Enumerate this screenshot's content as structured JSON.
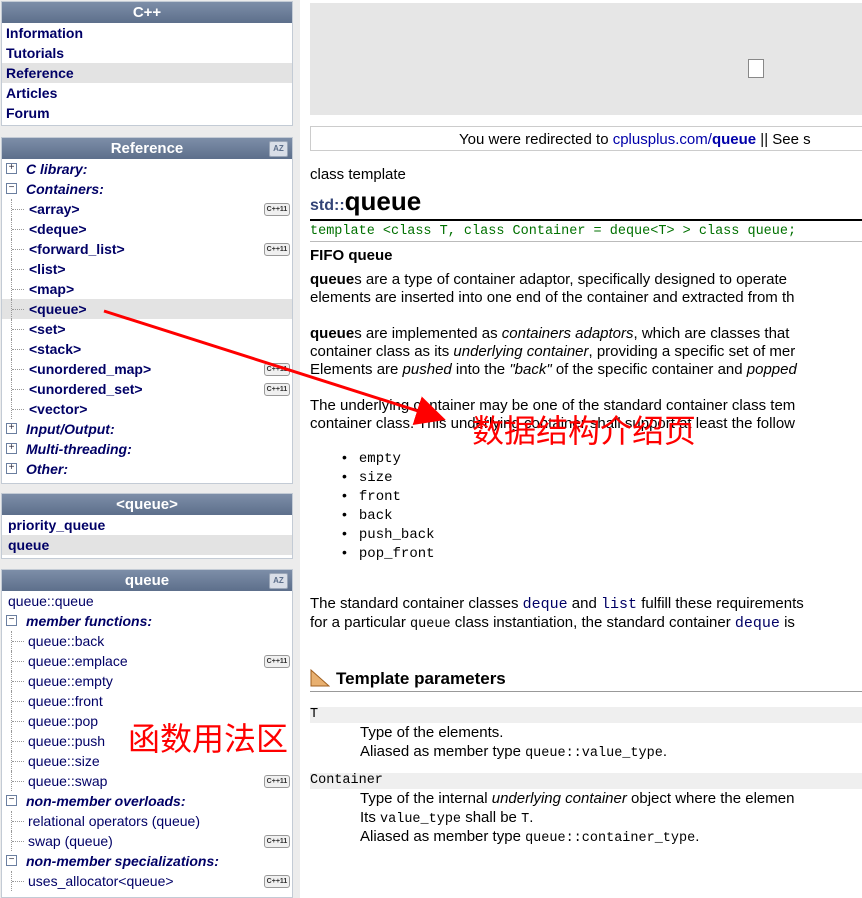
{
  "cpp_box": {
    "title": "C++",
    "items": [
      "Information",
      "Tutorials",
      "Reference",
      "Articles",
      "Forum"
    ],
    "selected": "Reference"
  },
  "reference_box": {
    "title": "Reference",
    "book_icon": "book-icon",
    "rows": [
      {
        "type": "cat",
        "label": "C library:",
        "pm": "+"
      },
      {
        "type": "cat",
        "label": "Containers:",
        "pm": "-"
      },
      {
        "type": "ent",
        "label": "<array>",
        "badge": "C++11"
      },
      {
        "type": "ent",
        "label": "<deque>"
      },
      {
        "type": "ent",
        "label": "<forward_list>",
        "badge": "C++11"
      },
      {
        "type": "ent",
        "label": "<list>"
      },
      {
        "type": "ent",
        "label": "<map>"
      },
      {
        "type": "ent",
        "label": "<queue>",
        "selected": true
      },
      {
        "type": "ent",
        "label": "<set>"
      },
      {
        "type": "ent",
        "label": "<stack>"
      },
      {
        "type": "ent",
        "label": "<unordered_map>",
        "badge": "C++11"
      },
      {
        "type": "ent",
        "label": "<unordered_set>",
        "badge": "C++11"
      },
      {
        "type": "ent",
        "label": "<vector>"
      },
      {
        "type": "cat",
        "label": "Input/Output:",
        "pm": "+"
      },
      {
        "type": "cat",
        "label": "Multi-threading:",
        "pm": "+"
      },
      {
        "type": "cat",
        "label": "Other:",
        "pm": "+"
      }
    ]
  },
  "queue_header_box": {
    "title": "<queue>",
    "items": [
      "priority_queue",
      "queue"
    ],
    "selected": "queue"
  },
  "queue_box": {
    "title": "queue",
    "rows": [
      {
        "type": "top",
        "label": "queue::queue"
      },
      {
        "type": "cat",
        "label": "member functions:",
        "pm": "-"
      },
      {
        "type": "mem",
        "label": "queue::back"
      },
      {
        "type": "mem",
        "label": "queue::emplace",
        "badge": "C++11"
      },
      {
        "type": "mem",
        "label": "queue::empty"
      },
      {
        "type": "mem",
        "label": "queue::front"
      },
      {
        "type": "mem",
        "label": "queue::pop"
      },
      {
        "type": "mem",
        "label": "queue::push"
      },
      {
        "type": "mem",
        "label": "queue::size"
      },
      {
        "type": "mem",
        "label": "queue::swap",
        "badge": "C++11"
      },
      {
        "type": "cat",
        "label": "non-member overloads:",
        "pm": "-"
      },
      {
        "type": "mem",
        "label": "relational operators (queue)"
      },
      {
        "type": "mem",
        "label": "swap (queue)",
        "badge": "C++11"
      },
      {
        "type": "cat",
        "label": "non-member specializations:",
        "pm": "-"
      },
      {
        "type": "mem",
        "label": "uses_allocator<queue>",
        "badge": "C++11"
      }
    ]
  },
  "badge_text": "C++11",
  "redirect": {
    "prefix": "You were redirected to ",
    "link_a": "cplusplus.com/",
    "link_b": "queue",
    "suffix": " || See s"
  },
  "article": {
    "kind": "class template",
    "ns": "std::",
    "name": "queue",
    "template_decl": "template <class T, class Container = deque<T> > class queue;",
    "subtitle": "FIFO queue",
    "p1": {
      "b": "queue",
      "rest": "s are a type of container adaptor, specifically designed to operate",
      "l2": "elements are inserted into one end of the container and extracted from th"
    },
    "p2": {
      "b": "queue",
      "a": "s are implemented as ",
      "i": "containers adaptors",
      "c": ", which are classes that",
      "l2a": "container class as its ",
      "l2i": "underlying container",
      "l2b": ", providing a specific set of mer",
      "l3a": "Elements are ",
      "l3i": "pushed",
      "l3b": " into the ",
      "l3i2": "\"back\"",
      "l3c": " of the specific container and ",
      "l3i3": "popped"
    },
    "p3": {
      "l1": "The underlying container may be one of the standard container class tem",
      "l2": "container class. This underlying container shall support at least the follow"
    },
    "ops": [
      "empty",
      "size",
      "front",
      "back",
      "push_back",
      "pop_front"
    ],
    "p4": {
      "a": "The standard container classes ",
      "k1": "deque",
      "b": " and ",
      "k2": "list",
      "c": " fulfill these requirements",
      "l2a": "for a particular ",
      "l2k": "queue",
      "l2b": " class instantiation, the standard container ",
      "l2k2": "deque",
      "l2c": " is"
    },
    "section": "Template parameters",
    "params": [
      {
        "name": "T",
        "lines": [
          {
            "a": "Type of the elements."
          },
          {
            "a": "Aliased as member type ",
            "k": "queue::value_type",
            "b": "."
          }
        ]
      },
      {
        "name": "Container",
        "lines": [
          {
            "a": "Type of the internal ",
            "i": "underlying container",
            "b": " object where the elemen"
          },
          {
            "a": "Its ",
            "k": "value_type",
            "b": " shall be ",
            "k2": "T",
            "c": "."
          },
          {
            "a": "Aliased as member type ",
            "k": "queue::container_type",
            "b": "."
          }
        ]
      }
    ]
  },
  "annotations": {
    "top": "数据结构介绍页",
    "bottom": "函数用法区",
    "color": "#ff0000"
  }
}
